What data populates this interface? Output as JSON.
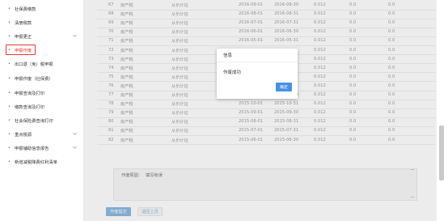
{
  "sidebar": {
    "items": [
      {
        "label": "社保费缴款",
        "chevron": false
      },
      {
        "label": "清册税款",
        "chevron": false
      },
      {
        "label": "申报更正",
        "chevron": true
      },
      {
        "label": "申报作废",
        "chevron": false,
        "active": true
      },
      {
        "label": "出口退（免）税申报",
        "chevron": false
      },
      {
        "label": "申报作废（社保费）",
        "chevron": false
      },
      {
        "label": "申报查询及打印",
        "chevron": false
      },
      {
        "label": "缴款查询及打印",
        "chevron": false
      },
      {
        "label": "社会保险费查询打印",
        "chevron": false
      },
      {
        "label": "重点税源",
        "chevron": true
      },
      {
        "label": "申报辅助信息报告",
        "chevron": true
      },
      {
        "label": "新增减税降费红利清单",
        "chevron": false
      }
    ]
  },
  "table": {
    "rows": [
      {
        "no": "67",
        "tax": "房产税",
        "item": "从价计征",
        "start": "2016-09-01",
        "end": "2016-09-30",
        "rate": "0.012",
        "a": "0.0",
        "b": "0.0"
      },
      {
        "no": "68",
        "tax": "房产税",
        "item": "从价计征",
        "start": "2016-08-01",
        "end": "2016-08-31",
        "rate": "0.012",
        "a": "0.0",
        "b": "0.0"
      },
      {
        "no": "69",
        "tax": "房产税",
        "item": "从价计征",
        "start": "2016-07-01",
        "end": "2016-07-31",
        "rate": "0.012",
        "a": "0.0",
        "b": "0.0"
      },
      {
        "no": "70",
        "tax": "房产税",
        "item": "从价计征",
        "start": "2016-06-01",
        "end": "2016-06-30",
        "rate": "0.012",
        "a": "0.0",
        "b": "0.0"
      },
      {
        "no": "71",
        "tax": "房产税",
        "item": "从价计征",
        "start": "2016-05-01",
        "end": "2016-05-31",
        "rate": "0.012",
        "a": "0.0",
        "b": "0.0"
      },
      {
        "no": "72",
        "tax": "房产税",
        "item": "从价计征",
        "start": "",
        "end": "",
        "rate": "0.012",
        "a": "0.0",
        "b": "0.0"
      },
      {
        "no": "73",
        "tax": "房产税",
        "item": "从价计征",
        "start": "",
        "end": "",
        "rate": "0.012",
        "a": "0.0",
        "b": "0.0"
      },
      {
        "no": "74",
        "tax": "房产税",
        "item": "从价计征",
        "start": "",
        "end": "",
        "rate": "0.012",
        "a": "0.0",
        "b": "0.0"
      },
      {
        "no": "75",
        "tax": "房产税",
        "item": "从价计征",
        "start": "",
        "end": "",
        "rate": "0.012",
        "a": "0.0",
        "b": "0.0"
      },
      {
        "no": "76",
        "tax": "房产税",
        "item": "从价计征",
        "start": "",
        "end": "",
        "rate": "0.012",
        "a": "0.0",
        "b": "0.0"
      },
      {
        "no": "77",
        "tax": "房产税",
        "item": "从价计征",
        "start": "2015-11-01",
        "end": "2015-11-30",
        "rate": "0.012",
        "a": "0.0",
        "b": "0.0"
      },
      {
        "no": "78",
        "tax": "房产税",
        "item": "从价计征",
        "start": "2015-10-01",
        "end": "2015-10-31",
        "rate": "0.012",
        "a": "0.0",
        "b": "0.0"
      },
      {
        "no": "79",
        "tax": "房产税",
        "item": "从价计征",
        "start": "2015-09-01",
        "end": "2015-09-30",
        "rate": "0.012",
        "a": "0.0",
        "b": "0.0"
      },
      {
        "no": "80",
        "tax": "房产税",
        "item": "从价计征",
        "start": "2015-08-01",
        "end": "2015-08-31",
        "rate": "0.012",
        "a": "0.0",
        "b": "0.0"
      },
      {
        "no": "81",
        "tax": "房产税",
        "item": "从价计征",
        "start": "2015-07-01",
        "end": "2015-07-31",
        "rate": "0.012",
        "a": "0.0",
        "b": "0.0"
      },
      {
        "no": "82",
        "tax": "房产税",
        "item": "从价计征",
        "start": "2015-06-01",
        "end": "2015-06-30",
        "rate": "0.012",
        "a": "0.0",
        "b": "0.0"
      }
    ]
  },
  "form": {
    "reason_label": "作废原因：",
    "reason_value": "填写有误"
  },
  "buttons": {
    "submit": "作废提交",
    "back": "返回上页"
  },
  "modal": {
    "title": "信息",
    "message": "作废成功",
    "confirm": "确定"
  },
  "colors": {
    "accent": "#4a90e2",
    "active_outline": "#e53935"
  }
}
